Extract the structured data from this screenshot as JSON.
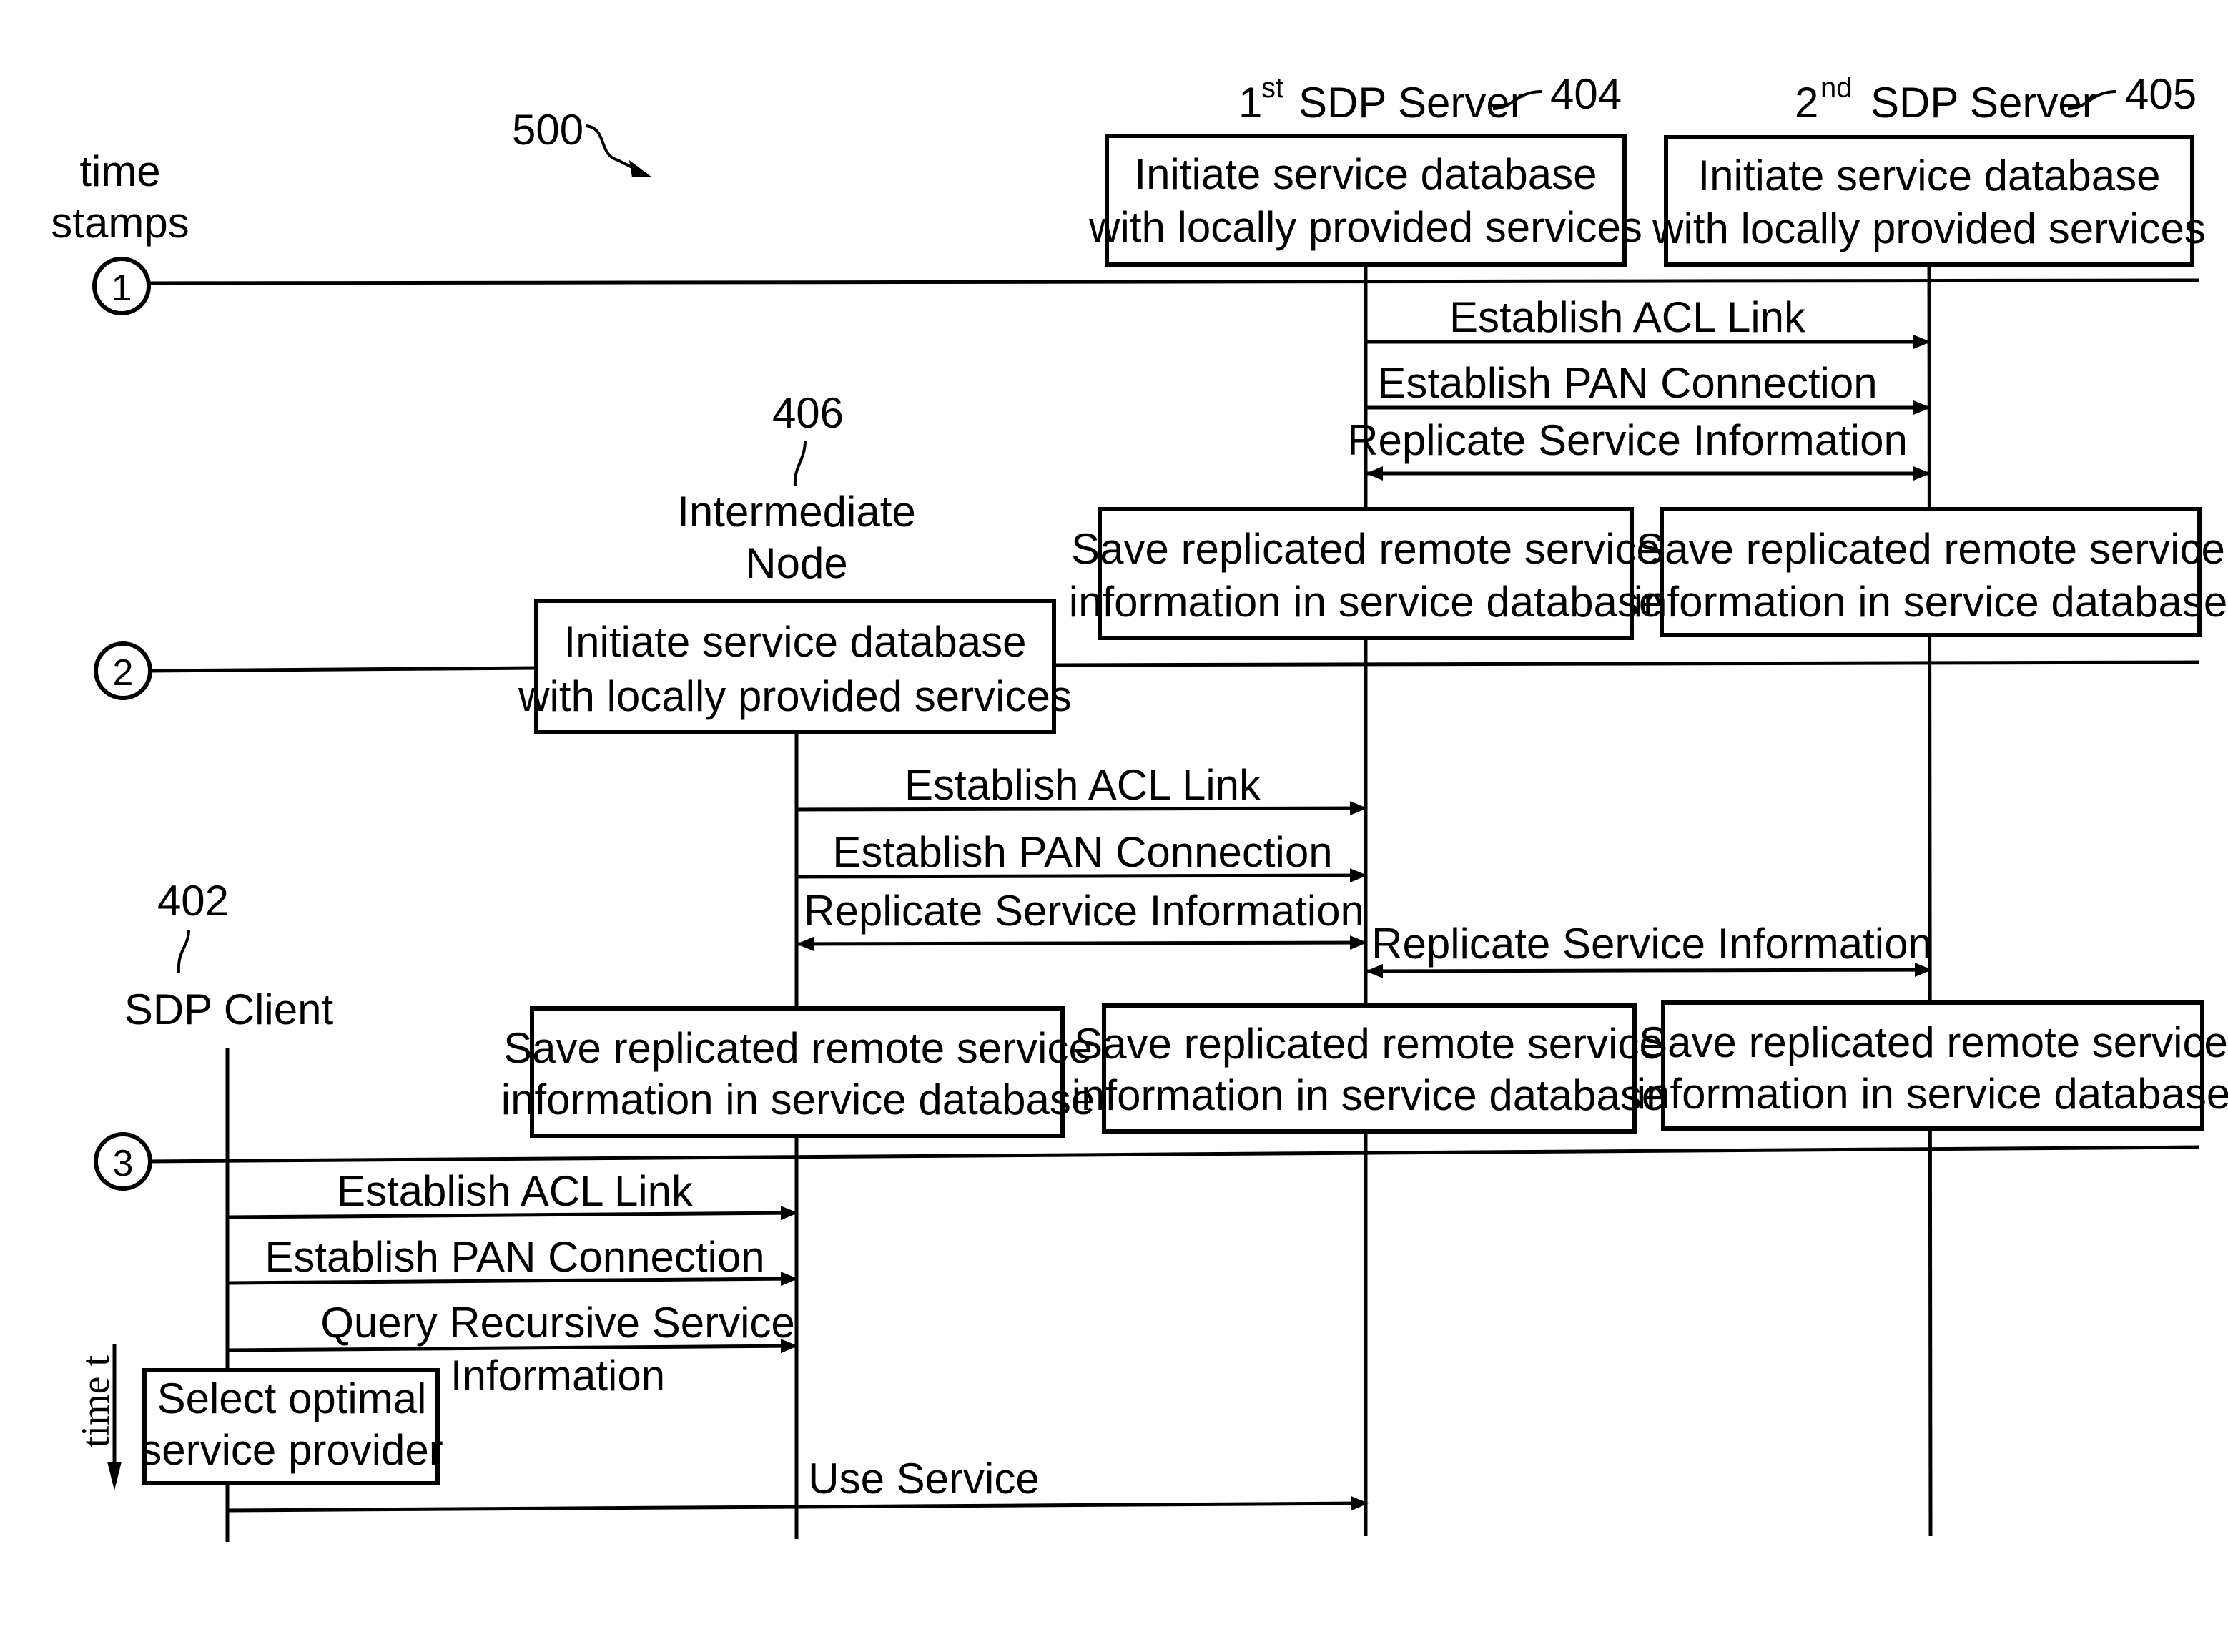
{
  "figure": {
    "reference_number": "500",
    "time_stamps_label": [
      "time",
      "stamps"
    ],
    "time_axis_label": "time t"
  },
  "time_stamps": [
    {
      "id": "ts1",
      "label": "1"
    },
    {
      "id": "ts2",
      "label": "2"
    },
    {
      "id": "ts3",
      "label": "3"
    }
  ],
  "participants": [
    {
      "id": "client",
      "name": "SDP Client",
      "ref": "402"
    },
    {
      "id": "intermediate",
      "name_lines": [
        "Intermediate",
        "Node"
      ],
      "ref": "406"
    },
    {
      "id": "server1",
      "ordinal": "1",
      "ordinal_suffix": "st",
      "name": "SDP Server",
      "ref": "404"
    },
    {
      "id": "server2",
      "ordinal": "2",
      "ordinal_suffix": "nd",
      "name": "SDP Server",
      "ref": "405"
    }
  ],
  "boxes": [
    {
      "id": "s1-init",
      "participant": "server1",
      "lines": [
        "Initiate service database",
        "with locally provided services"
      ]
    },
    {
      "id": "s2-init",
      "participant": "server2",
      "lines": [
        "Initiate service database",
        "with locally provided services"
      ]
    },
    {
      "id": "s1-save-1",
      "participant": "server1",
      "lines": [
        "Save replicated remote service",
        "information in service database"
      ]
    },
    {
      "id": "s2-save-1",
      "participant": "server2",
      "lines": [
        "Save replicated remote service",
        "information in service database"
      ]
    },
    {
      "id": "in-init",
      "participant": "intermediate",
      "lines": [
        "Initiate service database",
        "with locally provided services"
      ]
    },
    {
      "id": "in-save",
      "participant": "intermediate",
      "lines": [
        "Save replicated remote service",
        "information in service database"
      ]
    },
    {
      "id": "s1-save-2",
      "participant": "server1",
      "lines": [
        "Save replicated remote service",
        "information in service database"
      ]
    },
    {
      "id": "s2-save-2",
      "participant": "server2",
      "lines": [
        "Save replicated remote service",
        "information in service database"
      ]
    },
    {
      "id": "cl-select",
      "participant": "client",
      "lines": [
        "Select optimal",
        "service provider"
      ]
    }
  ],
  "messages": [
    {
      "id": "m1",
      "from": "server1",
      "to": "server2",
      "label": "Establish ACL Link",
      "direction": "forward"
    },
    {
      "id": "m2",
      "from": "server1",
      "to": "server2",
      "label": "Establish PAN Connection",
      "direction": "forward"
    },
    {
      "id": "m3",
      "from": "server1",
      "to": "server2",
      "label": "Replicate Service Information",
      "direction": "both"
    },
    {
      "id": "m4",
      "from": "intermediate",
      "to": "server1",
      "label": "Establish ACL Link",
      "direction": "forward"
    },
    {
      "id": "m5",
      "from": "intermediate",
      "to": "server1",
      "label": "Establish PAN Connection",
      "direction": "forward"
    },
    {
      "id": "m6",
      "from": "intermediate",
      "to": "server1",
      "label": "Replicate Service Information",
      "direction": "both"
    },
    {
      "id": "m7",
      "from": "server1",
      "to": "server2",
      "label": "Replicate Service Information",
      "direction": "both"
    },
    {
      "id": "m8",
      "from": "client",
      "to": "intermediate",
      "label": "Establish ACL Link",
      "direction": "forward"
    },
    {
      "id": "m9",
      "from": "client",
      "to": "intermediate",
      "label": "Establish PAN Connection",
      "direction": "forward"
    },
    {
      "id": "m10",
      "from": "client",
      "to": "intermediate",
      "label_lines": [
        "Query Recursive Service",
        "Information"
      ],
      "direction": "forward"
    },
    {
      "id": "m11",
      "from": "client",
      "to": "server1",
      "label": "Use Service",
      "direction": "forward"
    }
  ]
}
